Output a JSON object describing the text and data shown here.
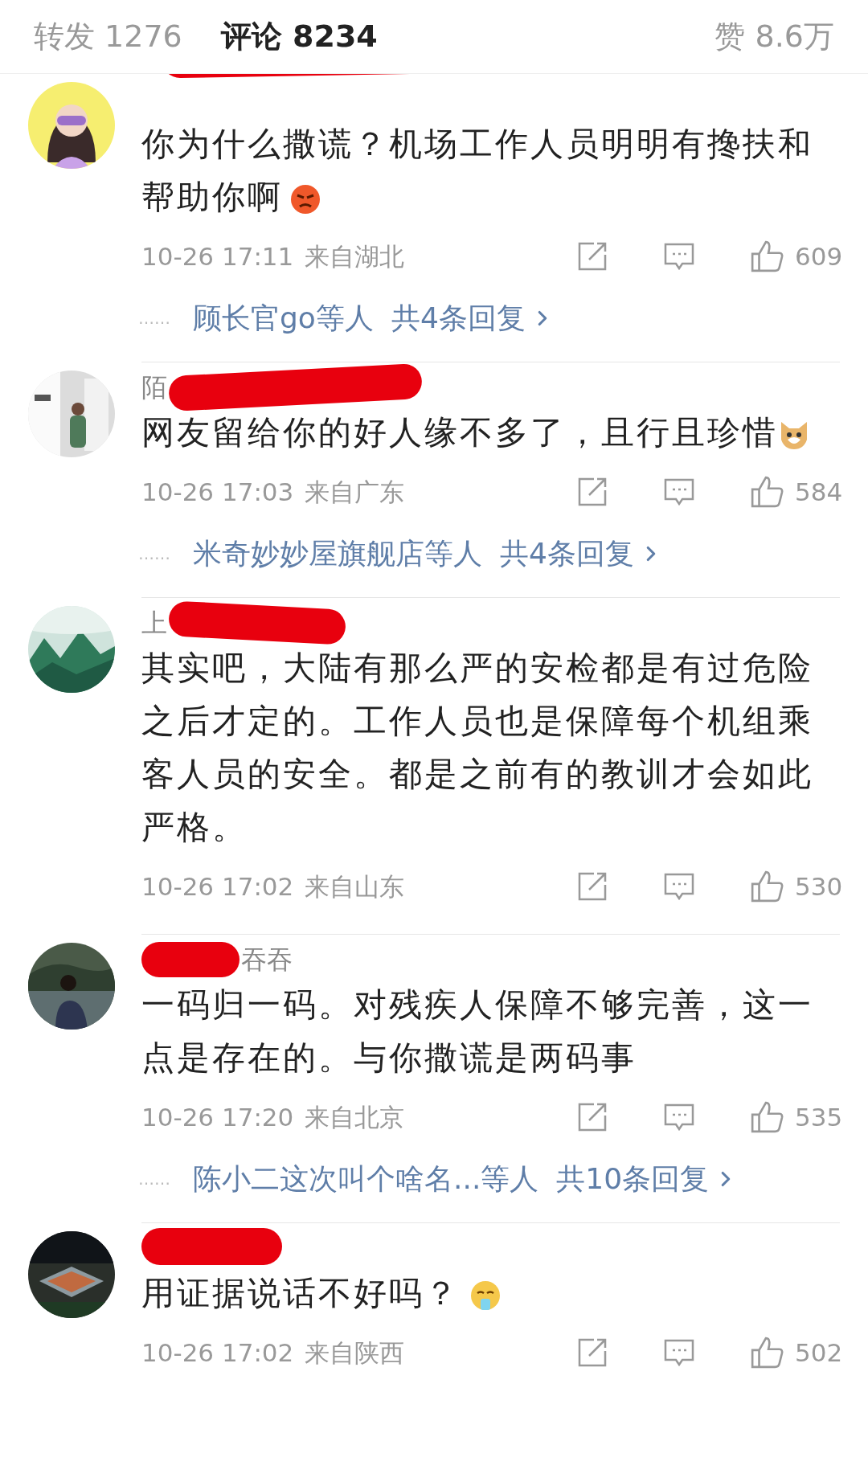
{
  "header": {
    "tabs": [
      {
        "label": "转发 1276",
        "selected": false
      },
      {
        "label": "评论 8234",
        "selected": true
      }
    ],
    "likes": "赞 8.6万"
  },
  "comments": [
    {
      "text": "你为什么撒谎？机场工作人员明明有搀扶和帮助你啊",
      "emoji": {
        "kind": "angry"
      },
      "time": "10-26 17:11",
      "location": "来自湖北",
      "like_count": "609",
      "replies": {
        "dots": "……",
        "users": "顾长官go等人",
        "total": "共4条回复"
      }
    },
    {
      "name": "陌",
      "text": "网友留给你的好人缘不多了，且行且珍惜",
      "emoji": {
        "kind": "dog"
      },
      "time": "10-26 17:03",
      "location": "来自广东",
      "like_count": "584",
      "replies": {
        "dots": "……",
        "users": "米奇妙妙屋旗舰店等人",
        "total": "共4条回复"
      }
    },
    {
      "name": "上",
      "text": "其实吧，大陆有那么严的安检都是有过危险之后才定的。工作人员也是保障每个机组乘客人员的安全。都是之前有的教训才会如此严格。",
      "time": "10-26 17:02",
      "location": "来自山东",
      "like_count": "530"
    },
    {
      "name": "吞吞",
      "text": "一码归一码。对残疾人保障不够完善，这一点是存在的。与你撒谎是两码事",
      "time": "10-26 17:20",
      "location": "来自北京",
      "like_count": "535",
      "replies": {
        "dots": "……",
        "users": "陈小二这次叫个啥名...等人",
        "total": "共10条回复"
      }
    },
    {
      "text": "用证据说话不好吗？",
      "emoji": {
        "kind": "sweat"
      },
      "time": "10-26 17:02",
      "location": "来自陕西",
      "like_count": "502"
    }
  ]
}
